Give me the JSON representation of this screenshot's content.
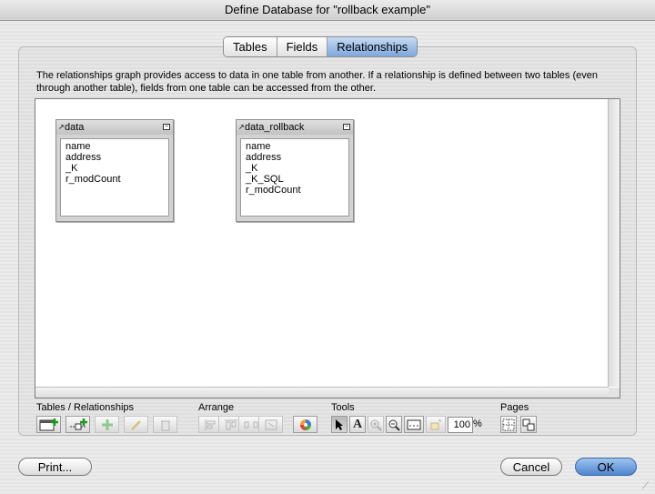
{
  "window": {
    "title": "Define Database for \"rollback example\""
  },
  "tabs": [
    {
      "label": "Tables"
    },
    {
      "label": "Fields"
    },
    {
      "label": "Relationships"
    }
  ],
  "description": "The relationships graph provides access to data in one table from another. If a relationship is defined between two tables (even through another table), fields from one table can be accessed from the other.",
  "tables": [
    {
      "name": "data",
      "fields": [
        "name",
        "address",
        "_K",
        "r_modCount"
      ]
    },
    {
      "name": "data_rollback",
      "fields": [
        "name",
        "address",
        "_K",
        "_K_SQL",
        "r_modCount"
      ]
    }
  ],
  "toolbar": {
    "groups": {
      "tables_relationships": "Tables / Relationships",
      "arrange": "Arrange",
      "tools": "Tools",
      "pages": "Pages"
    },
    "zoom_value": "100",
    "zoom_unit": "%"
  },
  "buttons": {
    "print": "Print...",
    "cancel": "Cancel",
    "ok": "OK"
  },
  "colors": {
    "accent": "#5b8fd6",
    "tab_active": "#9cbde9"
  },
  "icons": {
    "add_table": "add-table-icon",
    "add_relationship": "add-relationship-icon",
    "duplicate": "duplicate-icon",
    "edit": "edit-icon",
    "delete": "delete-icon",
    "color": "color-wheel-icon",
    "pointer": "pointer-icon",
    "text": "text-tool-icon",
    "zoom_in": "zoom-in-icon",
    "zoom_out": "zoom-out-icon",
    "relationships_display": "display-relationships-icon",
    "resize": "resize-icon",
    "page_breaks": "page-breaks-icon",
    "page_setup": "page-setup-icon"
  }
}
